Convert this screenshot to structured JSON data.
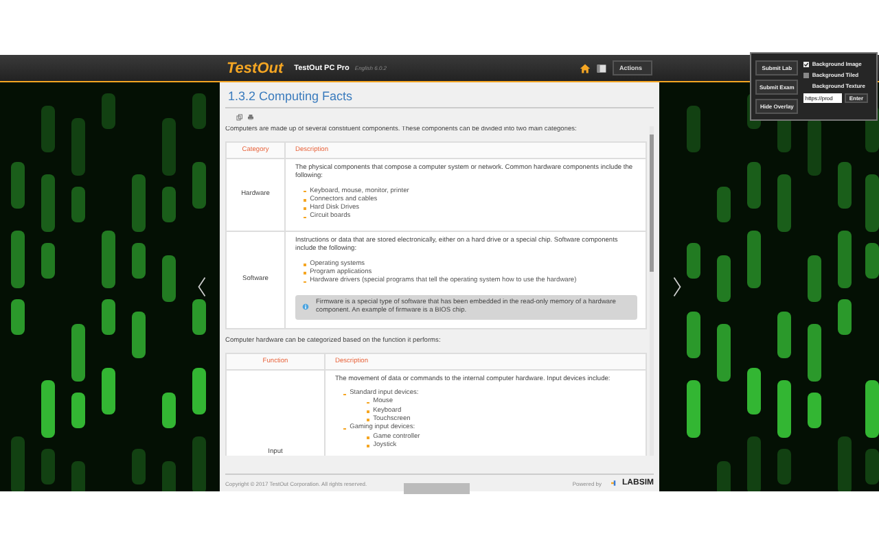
{
  "header": {
    "logo": "TestOut",
    "product": "TestOut PC Pro",
    "version": "English 6.0.2",
    "actions": "Actions"
  },
  "overlay": {
    "buttons": [
      "Submit Lab",
      "Submit Exam",
      "Hide Overlay"
    ],
    "options": [
      {
        "label": "Background Image",
        "checked": true
      },
      {
        "label": "Background Tiled",
        "checked": false
      }
    ],
    "texture_label": "Background Texture",
    "texture_value": "https://prod",
    "enter": "Enter"
  },
  "page": {
    "title": "1.3.2 Computing Facts",
    "intro": "Computers are made up of several constituent components. These components can be divided into two main categories:",
    "table1": {
      "columns": [
        "Category",
        "Description"
      ],
      "rows": [
        {
          "category": "Hardware",
          "text": "The physical components that compose a computer system or network. Common hardware components include the following:",
          "items": [
            "Keyboard, mouse, monitor, printer",
            "Connectors and cables",
            "Hard Disk Drives",
            "Circuit boards"
          ]
        },
        {
          "category": "Software",
          "text": "Instructions or data that are stored electronically, either on a hard drive or a special chip. Software components include the following:",
          "items": [
            "Operating systems",
            "Program applications",
            "Hardware drivers (special programs that tell the operating system how to use the hardware)"
          ],
          "note": "Firmware is a special type of software that has been embedded in the read-only memory of a hardware component. An example of firmware is a BIOS chip."
        }
      ]
    },
    "intro2": "Computer hardware can be categorized based on the function it performs:",
    "table2": {
      "columns": [
        "Function",
        "Description"
      ],
      "rows": [
        {
          "category": "Input",
          "text": "The movement of data or commands to the internal computer hardware. Input devices include:",
          "items": [
            {
              "text": "Standard input devices:",
              "children": [
                "Mouse",
                "Keyboard",
                "Touchscreen"
              ]
            },
            {
              "text": "Gaming input devices:",
              "children": [
                "Game controller",
                "Joystick"
              ]
            }
          ]
        }
      ]
    }
  },
  "footer": {
    "copyright": "Copyright © 2017 TestOut Corporation. All rights reserved.",
    "powered_by": "Powered by",
    "brand": "LABSIM"
  }
}
